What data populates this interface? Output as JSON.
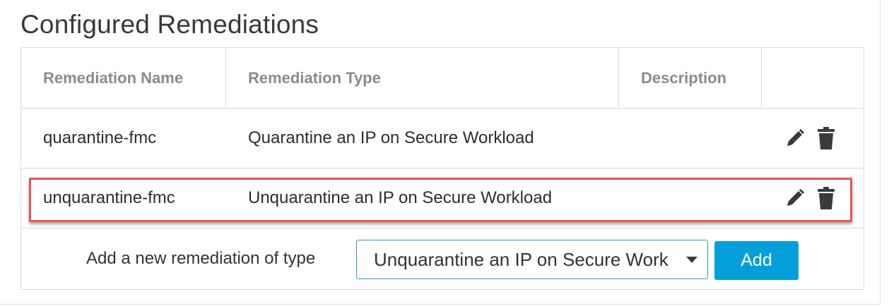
{
  "section_title": "Configured Remediations",
  "table": {
    "headers": [
      "Remediation Name",
      "Remediation Type",
      "Description",
      ""
    ],
    "rows": [
      {
        "name": "quarantine-fmc",
        "type": "Quarantine an IP on Secure Workload",
        "description": ""
      },
      {
        "name": "unquarantine-fmc",
        "type": "Unquarantine an IP on Secure Workload",
        "description": ""
      }
    ]
  },
  "add_row": {
    "label": "Add a new remediation of type",
    "selected_type": "Unquarantine an IP on Secure Workload",
    "add_button_label": "Add"
  },
  "icons": {
    "edit": "pencil-icon",
    "delete": "trash-icon",
    "dropdown": "caret-down-icon"
  },
  "colors": {
    "accent": "#049fd9",
    "select_border": "#2a9bd4",
    "highlight": "#e05a52",
    "header_text": "#8b8b8f"
  }
}
